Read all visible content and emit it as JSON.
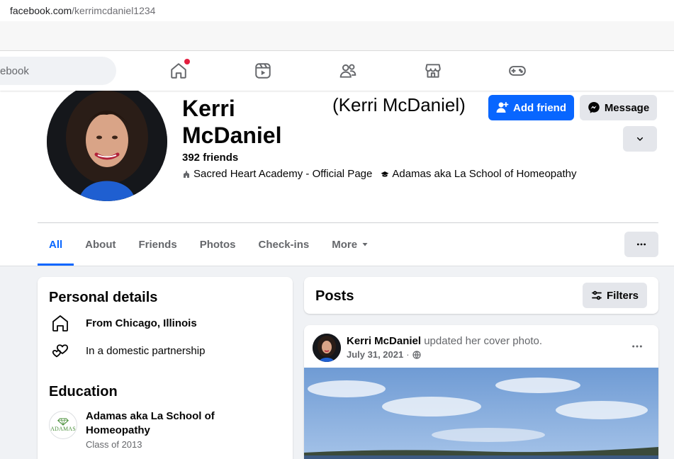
{
  "browser": {
    "url_host": "facebook.com",
    "url_path": "/kerrimcdaniel1234"
  },
  "topnav": {
    "search_placeholder": "ebook",
    "icons": [
      "home-icon",
      "reels-icon",
      "friends-icon",
      "marketplace-icon",
      "gaming-icon"
    ],
    "home_has_notification": true
  },
  "profile": {
    "name": "Kerri McDaniel",
    "alternate_name": "(Kerri McDaniel)",
    "friends": "392 friends",
    "affiliations": [
      {
        "icon": "school-icon",
        "label": "Sacred Heart Academy - Official Page"
      },
      {
        "icon": "graduation-cap-icon",
        "label": "Adamas aka La School of Homeopathy"
      }
    ],
    "add_friend_label": "Add friend",
    "message_label": "Message"
  },
  "tabs": [
    {
      "label": "All",
      "active": true
    },
    {
      "label": "About"
    },
    {
      "label": "Friends"
    },
    {
      "label": "Photos"
    },
    {
      "label": "Check-ins"
    },
    {
      "label": "More"
    }
  ],
  "personal_details": {
    "title": "Personal details",
    "items": [
      {
        "icon": "home-icon",
        "text": "From Chicago, Illinois"
      },
      {
        "icon": "hearts-icon",
        "text": "In a domestic partnership"
      }
    ]
  },
  "education": {
    "title": "Education",
    "logo_text": "ADAMAS",
    "school": "Adamas aka La School of Homeopathy",
    "class_of": "Class of 2013"
  },
  "posts": {
    "title": "Posts",
    "filters_label": "Filters",
    "items": [
      {
        "author": "Kerri McDaniel",
        "action": " updated her cover photo.",
        "date": "July 31, 2021",
        "separator": " · ",
        "privacy_icon": "globe-icon"
      }
    ]
  },
  "colors": {
    "brand_blue": "#0866ff",
    "secondary_gray": "#e4e6eb",
    "page_bg": "#f0f2f5",
    "notification_red": "#e41e3f"
  }
}
